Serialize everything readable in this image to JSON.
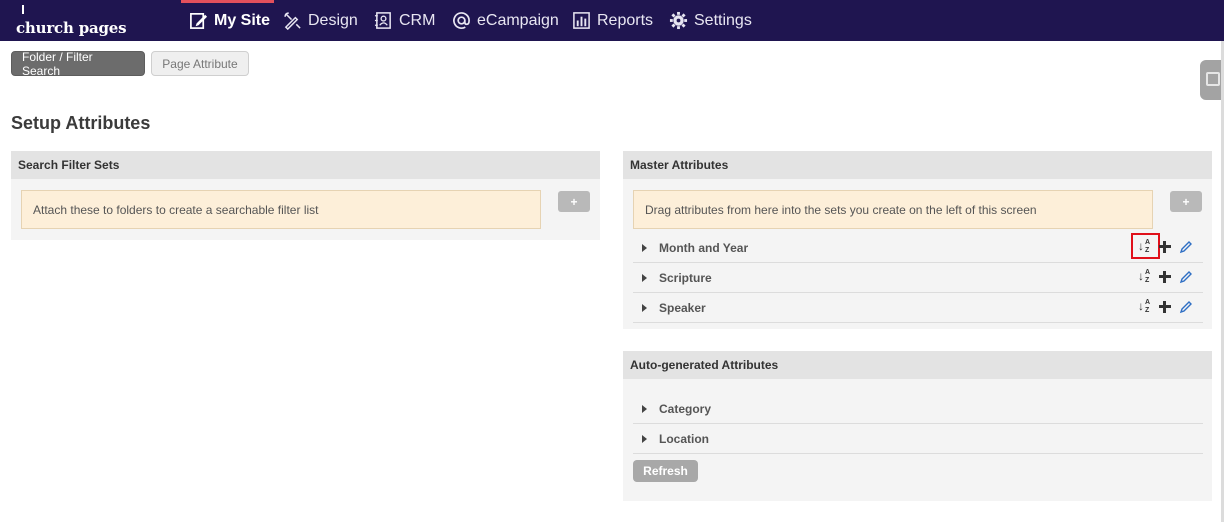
{
  "brand": {
    "logo_text": "church pages"
  },
  "nav": {
    "items": [
      {
        "label": "My Site",
        "icon": "edit-page-icon",
        "active": true
      },
      {
        "label": "Design",
        "icon": "design-tools-icon"
      },
      {
        "label": "CRM",
        "icon": "contacts-book-icon"
      },
      {
        "label": "eCampaign",
        "icon": "at-sign-icon"
      },
      {
        "label": "Reports",
        "icon": "bar-chart-icon"
      },
      {
        "label": "Settings",
        "icon": "gear-icon"
      }
    ]
  },
  "tabs": {
    "folder_filter_search": "Folder / Filter Search",
    "page_attribute": "Page Attribute"
  },
  "page": {
    "title": "Setup Attributes"
  },
  "search_filter_sets": {
    "heading": "Search Filter Sets",
    "hint": "Attach these to folders to create a searchable filter list",
    "add_label": "+"
  },
  "master_attributes": {
    "heading": "Master Attributes",
    "hint": "Drag attributes from here into the sets you create on the left of this screen",
    "add_label": "+",
    "items": [
      {
        "label": "Month and Year"
      },
      {
        "label": "Scripture"
      },
      {
        "label": "Speaker"
      }
    ],
    "sort_icon_letters": {
      "top": "A",
      "bottom": "Z"
    }
  },
  "auto_generated": {
    "heading": "Auto-generated Attributes",
    "items": [
      {
        "label": "Category"
      },
      {
        "label": "Location"
      }
    ],
    "refresh_label": "Refresh"
  },
  "colors": {
    "nav_background": "#1f1550",
    "nav_active_accent": "#e3505c",
    "highlight_box": "#e0101a",
    "edit_icon": "#2f6fc4"
  }
}
